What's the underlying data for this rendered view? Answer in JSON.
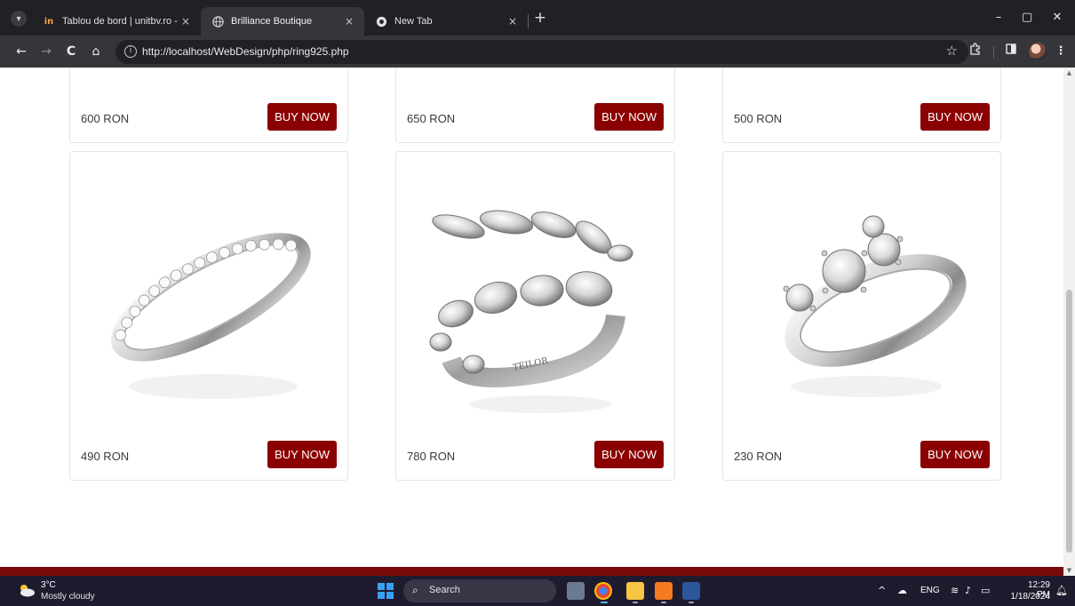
{
  "browser": {
    "tabs": [
      {
        "title": "Tablou de bord | unitbv.ro - e-l",
        "favicon": "unitbv-logo",
        "active": false
      },
      {
        "title": "Brilliance Boutique",
        "favicon": "globe-icon",
        "active": true
      },
      {
        "title": "New Tab",
        "favicon": "chrome-icon",
        "active": false
      }
    ],
    "tab_close": "×",
    "new_tab": "+",
    "window_controls": {
      "minimize": "–",
      "maximize": "▢",
      "close": "✕"
    },
    "nav": {
      "back": "←",
      "forward": "→",
      "reload": "C",
      "home": "⌂"
    },
    "url": "http://localhost/WebDesign/php/ring925.php",
    "bookmark": "☆"
  },
  "products": [
    {
      "price": "600 RON",
      "button": "BUY NOW"
    },
    {
      "price": "650 RON",
      "button": "BUY NOW"
    },
    {
      "price": "500 RON",
      "button": "BUY NOW"
    },
    {
      "price": "490 RON",
      "button": "BUY NOW",
      "image": "eternity-band-ring"
    },
    {
      "price": "780 RON",
      "button": "BUY NOW",
      "image": "marquise-pear-wrap-ring"
    },
    {
      "price": "230 RON",
      "button": "BUY NOW",
      "image": "three-stone-ring"
    }
  ],
  "theme": {
    "accent": "#8b0000",
    "footer": "#7a0a0a",
    "chrome_dark": "#202124",
    "chrome_toolbar": "#35363a",
    "taskbar": "#1f1b2e"
  },
  "taskbar": {
    "weather": {
      "temp": "3°C",
      "desc": "Mostly cloudy",
      "icon": "cloud-sun-icon"
    },
    "search_placeholder": "Search",
    "tray": {
      "chevron": "^",
      "language": "ENG"
    },
    "clock": {
      "time": "12:29 PM",
      "date": "1/18/2024"
    }
  }
}
